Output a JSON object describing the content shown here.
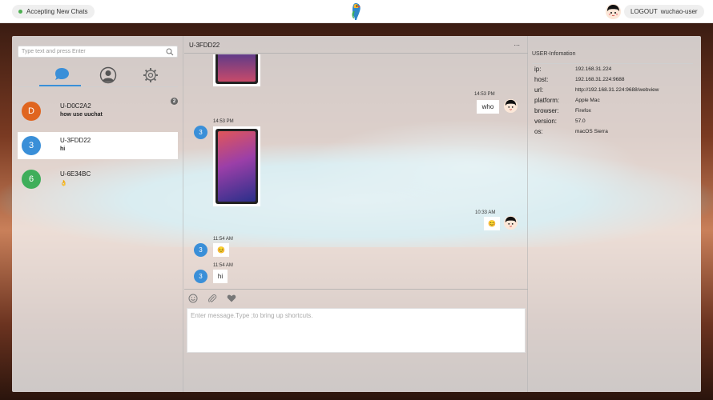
{
  "topbar": {
    "status_label": "Accepting New Chats",
    "logout_label": "LOGOUT",
    "username": "wuchao-user",
    "logo_text": "uuchat"
  },
  "sidebar": {
    "search_placeholder": "Type text and press Enter",
    "tabs": [
      "chats-icon",
      "user-icon",
      "settings-icon"
    ],
    "conversations": [
      {
        "initial": "D",
        "name": "U-D0C2A2",
        "message": "how use uuchat",
        "badge": "2",
        "color": "#e0651f"
      },
      {
        "initial": "3",
        "name": "U-3FDD22",
        "message": "hi",
        "badge": "",
        "color": "#3a8fd8"
      },
      {
        "initial": "6",
        "name": "U-6E34BC",
        "message": "👌",
        "badge": "",
        "color": "#3fae5a"
      }
    ]
  },
  "chat": {
    "title": "U-3FDD22",
    "more_label": "...",
    "messages": [
      {
        "time": "14:53 PM",
        "text": "who",
        "dir": "out"
      },
      {
        "time": "14:53 PM",
        "text": "",
        "dir": "in",
        "type": "image"
      },
      {
        "time": "10:33 AM",
        "text": "😊",
        "dir": "out"
      },
      {
        "time": "11:54 AM",
        "text": "😊",
        "dir": "in"
      },
      {
        "time": "11:54 AM",
        "text": "hi",
        "dir": "in"
      }
    ],
    "avatar_initial": "3",
    "composer_placeholder": "Enter message.Type ;to bring up shortcuts."
  },
  "info": {
    "title": "USER-Infomation",
    "rows": [
      {
        "key": "ip:",
        "value": "192.168.31.224"
      },
      {
        "key": "host:",
        "value": "192.168.31.224:9688"
      },
      {
        "key": "url:",
        "value": "http://192.168.31.224:9688/webview"
      },
      {
        "key": "platform:",
        "value": "Apple Mac"
      },
      {
        "key": "browser:",
        "value": "Firefox"
      },
      {
        "key": "version:",
        "value": "57.0"
      },
      {
        "key": "os:",
        "value": "macOS Sierra"
      }
    ]
  },
  "colors": {
    "accent": "#3a8fd8",
    "online": "#4caf50"
  }
}
